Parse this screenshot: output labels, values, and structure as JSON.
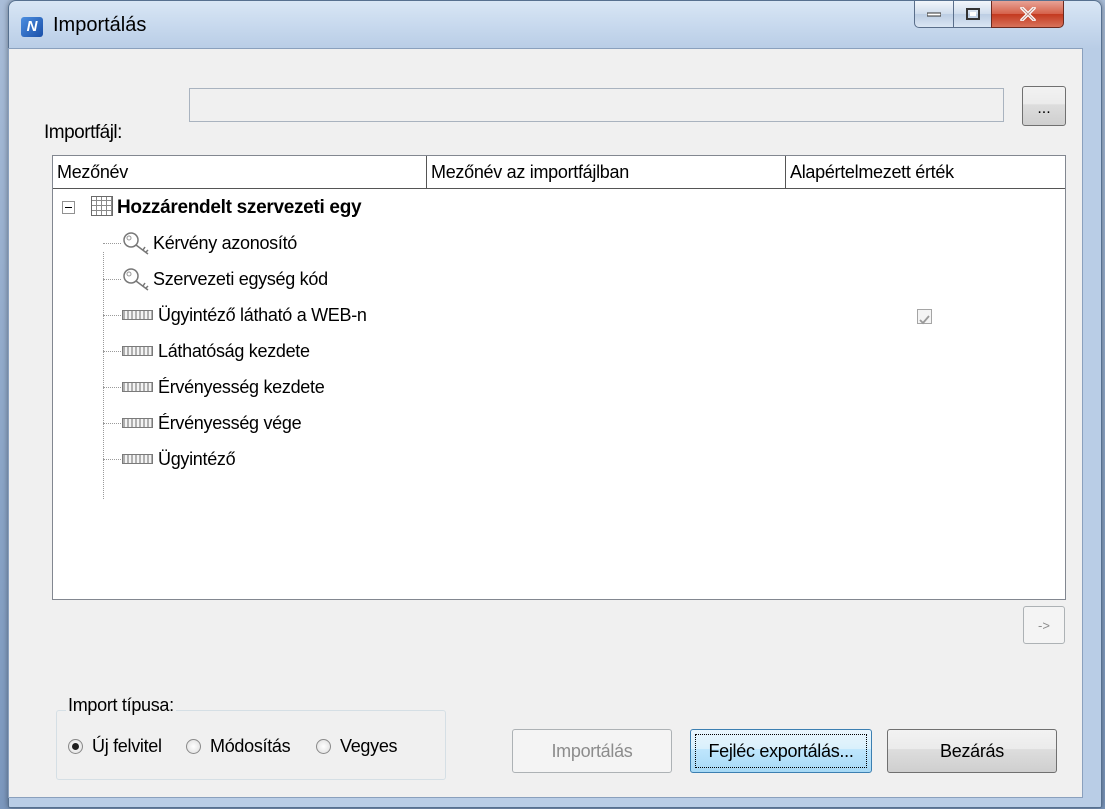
{
  "window": {
    "title": "Importálás",
    "app_icon_glyph": "N",
    "controls": {
      "minimize": "minimize-icon",
      "maximize": "maximize-icon",
      "close": "close-icon"
    }
  },
  "import_file": {
    "label": "Importfájl:",
    "value": "",
    "browse_label": "..."
  },
  "grid": {
    "columns": [
      "Mezőnév",
      "Mezőnév az importfájlban",
      "Alapértelmezett érték"
    ],
    "root": {
      "label": "Hozzárendelt szervezeti egy",
      "expanded": true
    },
    "fields": [
      {
        "label": "Kérvény azonosító",
        "icon": "key-icon",
        "default_checked": null
      },
      {
        "label": "Szervezeti egység kód",
        "icon": "key-icon",
        "default_checked": null
      },
      {
        "label": "Ügyintéző látható a WEB-n",
        "icon": "field-icon",
        "default_checked": true
      },
      {
        "label": "Láthatóság kezdete",
        "icon": "field-icon",
        "default_checked": null
      },
      {
        "label": "Érvényesség kezdete",
        "icon": "field-icon",
        "default_checked": null
      },
      {
        "label": "Érvényesség vége",
        "icon": "field-icon",
        "default_checked": null
      },
      {
        "label": "Ügyintéző",
        "icon": "field-icon",
        "default_checked": null
      }
    ]
  },
  "arrow_button_label": "->",
  "import_type": {
    "title": "Import típusa:",
    "options": [
      "Új felvitel",
      "Módosítás",
      "Vegyes"
    ],
    "selected": "Új felvitel"
  },
  "buttons": {
    "import": "Importálás",
    "export_header": "Fejléc exportálás...",
    "close": "Bezárás"
  },
  "colors": {
    "client_bg": "#f0f0f0",
    "close_button": "#c3391f",
    "focused_button": "#bee6fd"
  }
}
